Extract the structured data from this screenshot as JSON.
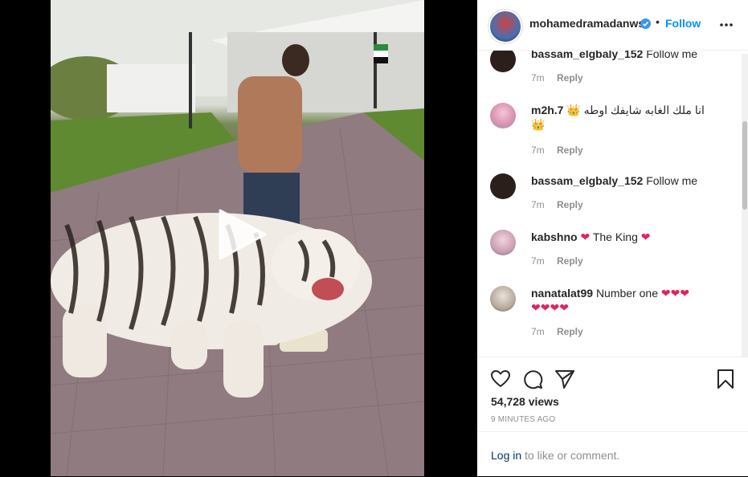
{
  "post": {
    "username": "mohamedramadanws",
    "dot": "•",
    "follow_label": "Follow",
    "verified": true,
    "accent": "#0095f6"
  },
  "comments": [
    {
      "user": "bassam_elgbaly_152",
      "text": "Follow me",
      "time": "7m",
      "reply": "Reply"
    },
    {
      "user": "m2h.7",
      "text": "انا ملك الغابه شايفك اوطه 👑",
      "extra": "👑",
      "time": "7m",
      "reply": "Reply"
    },
    {
      "user": "bassam_elgbaly_152",
      "text": "Follow me",
      "time": "7m",
      "reply": "Reply"
    },
    {
      "user": "kabshno",
      "text": "The King",
      "time": "7m",
      "reply": "Reply"
    },
    {
      "user": "nanatalat99",
      "text": "Number one",
      "time": "7m",
      "reply": "Reply"
    }
  ],
  "stats": {
    "views": "54,728 views",
    "time_ago": "9 MINUTES AGO"
  },
  "footer": {
    "login_link": "Log in",
    "login_rest": " to like or comment."
  },
  "icons": [
    "play-icon",
    "verified-badge-icon",
    "more-options-icon",
    "heart-icon",
    "comment-icon",
    "share-icon",
    "bookmark-icon"
  ]
}
